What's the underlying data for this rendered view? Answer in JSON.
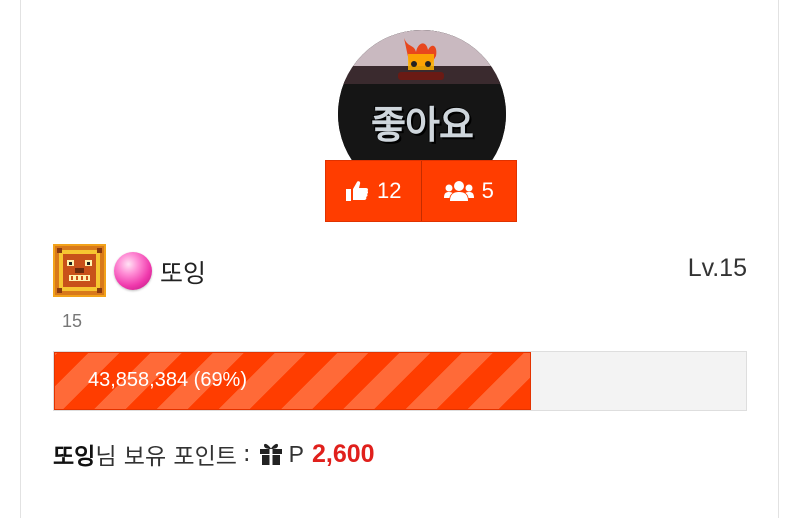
{
  "profile": {
    "avatar_caption": "좋아요",
    "likes": "12",
    "friends": "5"
  },
  "user": {
    "nickname": "또잉",
    "level_label": "Lv.15",
    "level_number": "15",
    "level_badge_icon": "pixel-lion-badge-icon",
    "orb_icon": "pink-orb-icon"
  },
  "experience": {
    "text": "43,858,384 (69%)",
    "percent": 69
  },
  "points": {
    "name": "또잉",
    "suffix": "님 보유 포인트",
    "separator": ":",
    "p_label": "P",
    "amount": "2,600"
  },
  "colors": {
    "accent": "#ff3d00",
    "amount": "#e0201c"
  }
}
